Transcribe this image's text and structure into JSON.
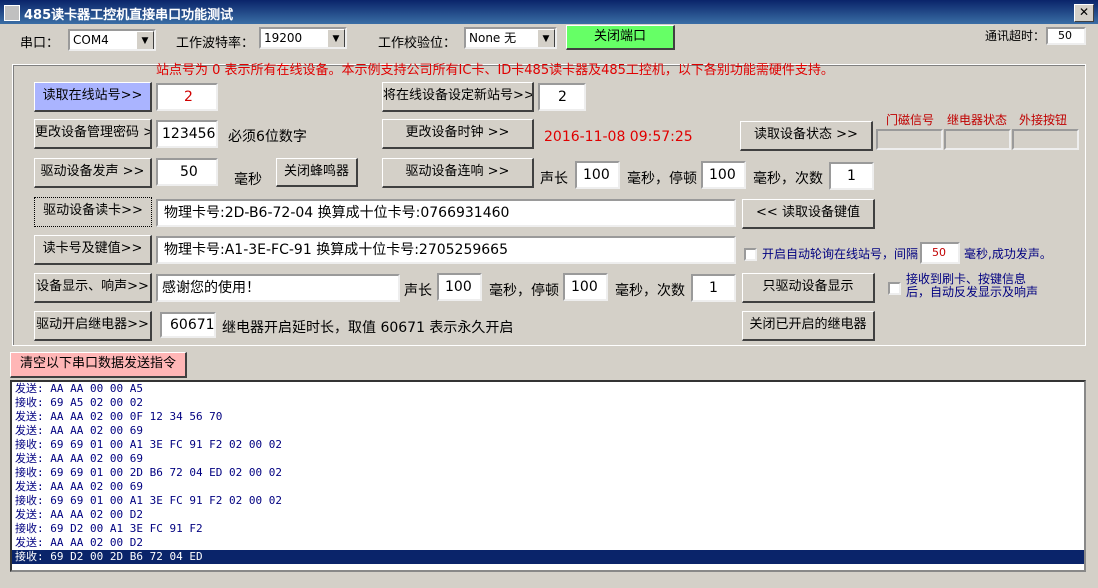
{
  "window": {
    "title": "485读卡器工控机直接串口功能测试",
    "close_glyph": "✕"
  },
  "top": {
    "port_label": "串口：",
    "port_value": "COM4",
    "baud_label": "工作波特率：",
    "baud_value": "19200",
    "parity_label": "工作校验位：",
    "parity_value": "None  无",
    "close_port_label": "关闭端口",
    "timeout_label": "通讯超时：",
    "timeout_value": "50"
  },
  "notice": "站点号为 0 表示所有在线设备。本示例支持公司所有IC卡、ID卡485读卡器及485工控机，以下各别功能需硬件支持。",
  "rows": {
    "read_station_btn": "读取在线站号>>",
    "station_value": "2",
    "set_station_btn": "将在线设备设定新站号>>",
    "new_station_value": "2",
    "change_pwd_btn": "更改设备管理密码 >",
    "pwd_value": "123456",
    "pwd_hint": "必须6位数字",
    "change_clock_btn": "更改设备时钟 >>",
    "clock_value": "2016-11-08 09:57:25",
    "read_status_btn": "读取设备状态 >>",
    "status_door": "门磁信号",
    "status_relay": "继电器状态",
    "status_ext": "外接按钮",
    "beep_btn": "驱动设备发声 >>",
    "beep_ms": "50",
    "ms_unit": "毫秒",
    "close_buzzer_btn": "关闭蜂鸣器",
    "beep_seq_btn": "驱动设备连响 >>",
    "sound_len_label": "声长",
    "sound_len": "100",
    "pause_label": "毫秒，停顿",
    "pause": "100",
    "times_label": "毫秒，次数",
    "times": "1",
    "read_card_btn": "驱动设备读卡>>",
    "read_card_result": "物理卡号:2D-B6-72-04  换算成十位卡号:0766931460",
    "read_key_btn": "<< 读取设备键值",
    "card_key_btn": "读卡号及键值>>",
    "card_key_result": "物理卡号:A1-3E-FC-91  换算成十位卡号:2705259665",
    "auto_poll_label": "开启自动轮询在线站号，间隔",
    "auto_poll_interval": "50",
    "auto_poll_suffix": "毫秒,成功发声。",
    "display_btn": "设备显示、响声>>",
    "display_text": "感谢您的使用！",
    "disp_sound_len": "100",
    "disp_pause": "100",
    "disp_times": "1",
    "display_only_btn": "只驱动设备显示",
    "feedback_label_1": "接收到刷卡、按键信息",
    "feedback_label_2": "后，自动反发显示及响声",
    "relay_btn": "驱动开启继电器>>",
    "relay_value": "60671",
    "relay_hint": "继电器开启延时长，取值 60671 表示永久开启",
    "close_relay_btn": "关闭已开启的继电器"
  },
  "clear_btn": "清空以下串口数据发送指令",
  "log": [
    "发送: AA AA 00 00 A5",
    "接收: 69 A5 02 00 02",
    "发送: AA AA 02 00 0F 12 34 56 70",
    "发送: AA AA 02 00 69",
    "接收: 69 69 01 00 A1 3E FC 91 F2 02 00 02",
    "发送: AA AA 02 00 69",
    "接收: 69 69 01 00 2D B6 72 04 ED 02 00 02",
    "发送: AA AA 02 00 69",
    "接收: 69 69 01 00 A1 3E FC 91 F2 02 00 02",
    "发送: AA AA 02 00 D2",
    "接收: 69 D2 00 A1 3E FC 91 F2",
    "发送: AA AA 02 00 D2",
    "接收: 69 D2 00 2D B6 72 04 ED"
  ],
  "colors": {
    "close_port_bg": "#66ff66",
    "read_station_bg": "#aab4ff",
    "clear_btn_bg": "#ffb6b6",
    "notice": "#e00000"
  }
}
